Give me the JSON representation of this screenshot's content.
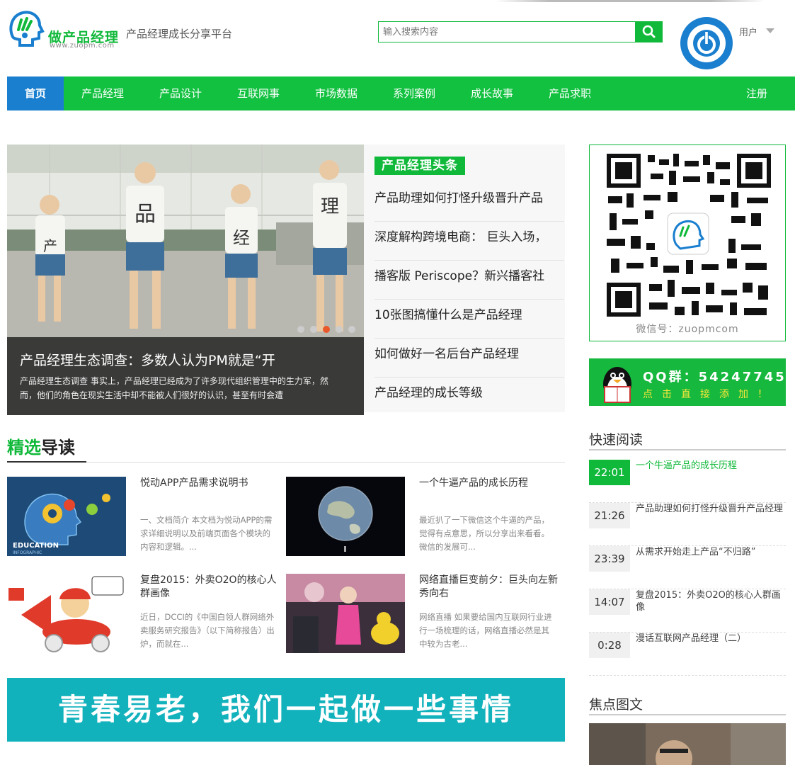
{
  "header": {
    "logo_text": "做产品经理",
    "logo_url": "www.zuopm.com",
    "slogan": "产品经理成长分享平台",
    "search_placeholder": "输入搜索内容",
    "user_label": "用户",
    "brand_color": "#10b93a",
    "accent_color": "#1a7fcf"
  },
  "nav": {
    "items": [
      "首页",
      "产品经理",
      "产品设计",
      "互联网事",
      "市场数据",
      "系列案例",
      "成长故事",
      "产品求职"
    ],
    "active": "首页",
    "register": "注册"
  },
  "slider": {
    "title": "产品经理生态调查：多数人认为PM就是“开",
    "desc": "产品经理生态调查 事实上，产品经理已经成为了许多现代组织管理中的生力军，然而，他们的角色在现实生活中却不能被人们很好的认识，甚至有时会遭",
    "shirt_chars": [
      "产",
      "品",
      "经",
      "理"
    ],
    "active_dot": 3
  },
  "headlines": {
    "badge": "产品经理头条",
    "items": [
      "产品助理如何打怪升级晋升产品",
      "深度解构跨境电商： 巨头入场，",
      "播客版 Periscope？新兴播客社",
      "10张图搞懂什么是产品经理",
      "如何做好一名后台产品经理",
      "产品经理的成长等级"
    ]
  },
  "featured": {
    "title_green": "精选",
    "title_dark": "导读",
    "articles": [
      {
        "title": "悦动APP产品需求说明书",
        "desc": "一、文档简介 本文档为悦动APP的需求详细说明以及前端页面各个模块的内容和逻辑。...",
        "img_label": "EDUCATION",
        "img_sub": "INFOGRAPHIC"
      },
      {
        "title": "一个牛逼产品的成长历程",
        "desc": "最近扒了一下微信这个牛逼的产品，觉得有点意思，所以分享出来看看。微信的发展可...",
        "img_label": "",
        "img_sub": ""
      },
      {
        "title": "复盘2015：外卖O2O的核心人群画像",
        "desc": "近日，DCCI的《中国白领人群网络外卖服务研究报告》（以下简称报告）出炉，而就在...",
        "img_label": "",
        "img_sub": ""
      },
      {
        "title": "网络直播巨变前夕：巨头向左新秀向右",
        "desc": "网络直播 如果要给国内互联网行业进行一场梳理的话，网络直播必然是其中较为古老...",
        "img_label": "",
        "img_sub": ""
      }
    ]
  },
  "banner": {
    "text": "青春易老，我们一起做一些事情"
  },
  "sidebar": {
    "wechat_label": "微信号：zuopmcom",
    "qq_title": "QQ群：54247745",
    "qq_sub": "点击直接添加！",
    "quick_read_title": "快速阅读",
    "quick_read": [
      {
        "time": "22:01",
        "text": "一个牛逼产品的成长历程",
        "hot": true
      },
      {
        "time": "21:26",
        "text": "产品助理如何打怪升级晋升产品经理",
        "hot": false
      },
      {
        "time": "23:39",
        "text": "从需求开始走上产品“不归路”",
        "hot": false
      },
      {
        "time": "14:07",
        "text": "复盘2015：外卖O2O的核心人群画像",
        "hot": false
      },
      {
        "time": "0:28",
        "text": "漫话互联网产品经理（二）",
        "hot": false
      }
    ],
    "focus_title": "焦点图文"
  }
}
